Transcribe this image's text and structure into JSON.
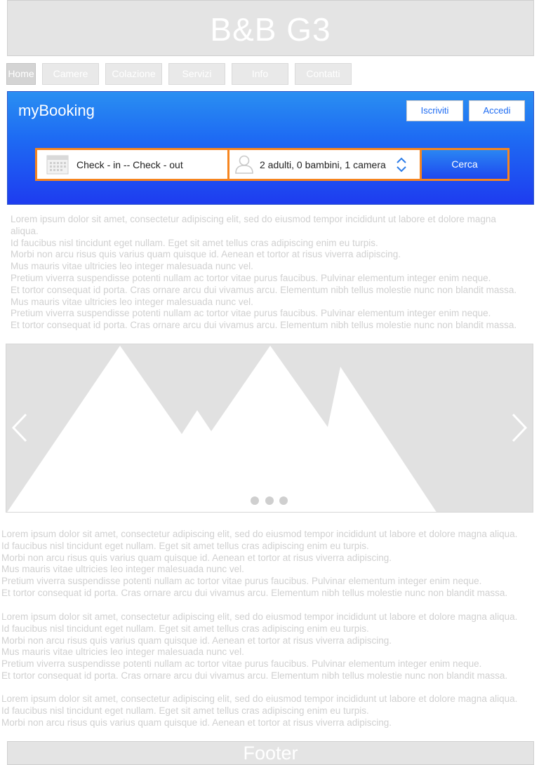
{
  "header": {
    "title": "B&B G3"
  },
  "nav": {
    "items": [
      "Home",
      "Camere",
      "Colazione",
      "Servizi",
      "Info",
      "Contatti"
    ],
    "active": "Home"
  },
  "booking": {
    "brand": "myBooking",
    "signup_label": "Iscriviti",
    "login_label": "Accedi",
    "dates_text": "Check - in -- Check - out",
    "guests_text": "2 adulti, 0 bambini, 1 camera",
    "search_label": "Cerca",
    "icons": [
      "calendar-icon",
      "user-icon",
      "updown-chevron-icon"
    ],
    "colors": {
      "accent_border": "#f7851f",
      "hero_top": "#2a8ff2",
      "hero_bottom": "#1e3cf0"
    }
  },
  "intro": {
    "lines": [
      "Lorem ipsum dolor sit amet, consectetur adipiscing elit, sed do eiusmod tempor incididunt ut labore et dolore magna",
      "aliqua.",
      "Id faucibus nisl tincidunt eget nullam. Eget sit amet tellus cras adipiscing enim eu turpis.",
      "Morbi non arcu risus quis varius quam quisque id. Aenean et tortor at risus viverra adipiscing.",
      "Mus mauris vitae ultricies leo integer malesuada nunc vel.",
      "Pretium viverra suspendisse potenti nullam ac tortor vitae purus faucibus. Pulvinar elementum integer enim neque.",
      "Et tortor consequat id porta. Cras ornare arcu dui vivamus arcu. Elementum nibh tellus molestie nunc non blandit massa.",
      "Mus mauris vitae ultricies leo integer malesuada nunc vel.",
      "Pretium viverra suspendisse potenti nullam ac tortor vitae purus faucibus. Pulvinar elementum integer enim neque.",
      "Et tortor consequat id porta. Cras ornare arcu dui vivamus arcu. Elementum nibh tellus molestie nunc non blandit massa."
    ]
  },
  "carousel": {
    "slide_count": 3,
    "icons": [
      "chevron-left-icon",
      "chevron-right-icon",
      "image-placeholder-icon"
    ]
  },
  "body_paragraphs": [
    {
      "lines": [
        "Lorem ipsum dolor sit amet, consectetur adipiscing elit, sed do eiusmod tempor incididunt ut labore et dolore magna aliqua.",
        "Id faucibus nisl tincidunt eget nullam. Eget sit amet tellus cras adipiscing enim eu turpis.",
        "Morbi non arcu risus quis varius quam quisque id. Aenean et tortor at risus viverra adipiscing.",
        "Mus mauris vitae ultricies leo integer malesuada nunc vel.",
        "Pretium viverra suspendisse potenti nullam ac tortor vitae purus faucibus. Pulvinar elementum integer enim neque.",
        "Et tortor consequat id porta. Cras ornare arcu dui vivamus arcu. Elementum nibh tellus molestie nunc non blandit massa."
      ]
    },
    {
      "lines": [
        "Lorem ipsum dolor sit amet, consectetur adipiscing elit, sed do eiusmod tempor incididunt ut labore et dolore magna aliqua.",
        "Id faucibus nisl tincidunt eget nullam. Eget sit amet tellus cras adipiscing enim eu turpis.",
        "Morbi non arcu risus quis varius quam quisque id. Aenean et tortor at risus viverra adipiscing.",
        "Mus mauris vitae ultricies leo integer malesuada nunc vel.",
        "Pretium viverra suspendisse potenti nullam ac tortor vitae purus faucibus. Pulvinar elementum integer enim neque.",
        "Et tortor consequat id porta. Cras ornare arcu dui vivamus arcu. Elementum nibh tellus molestie nunc non blandit massa."
      ]
    },
    {
      "lines": [
        "Lorem ipsum dolor sit amet, consectetur adipiscing elit, sed do eiusmod tempor incididunt ut labore et dolore magna aliqua.",
        "Id faucibus nisl tincidunt eget nullam. Eget sit amet tellus cras adipiscing enim eu turpis.",
        "Morbi non arcu risus quis varius quam quisque id. Aenean et tortor at risus viverra adipiscing."
      ]
    }
  ],
  "footer": {
    "text": "Footer"
  }
}
